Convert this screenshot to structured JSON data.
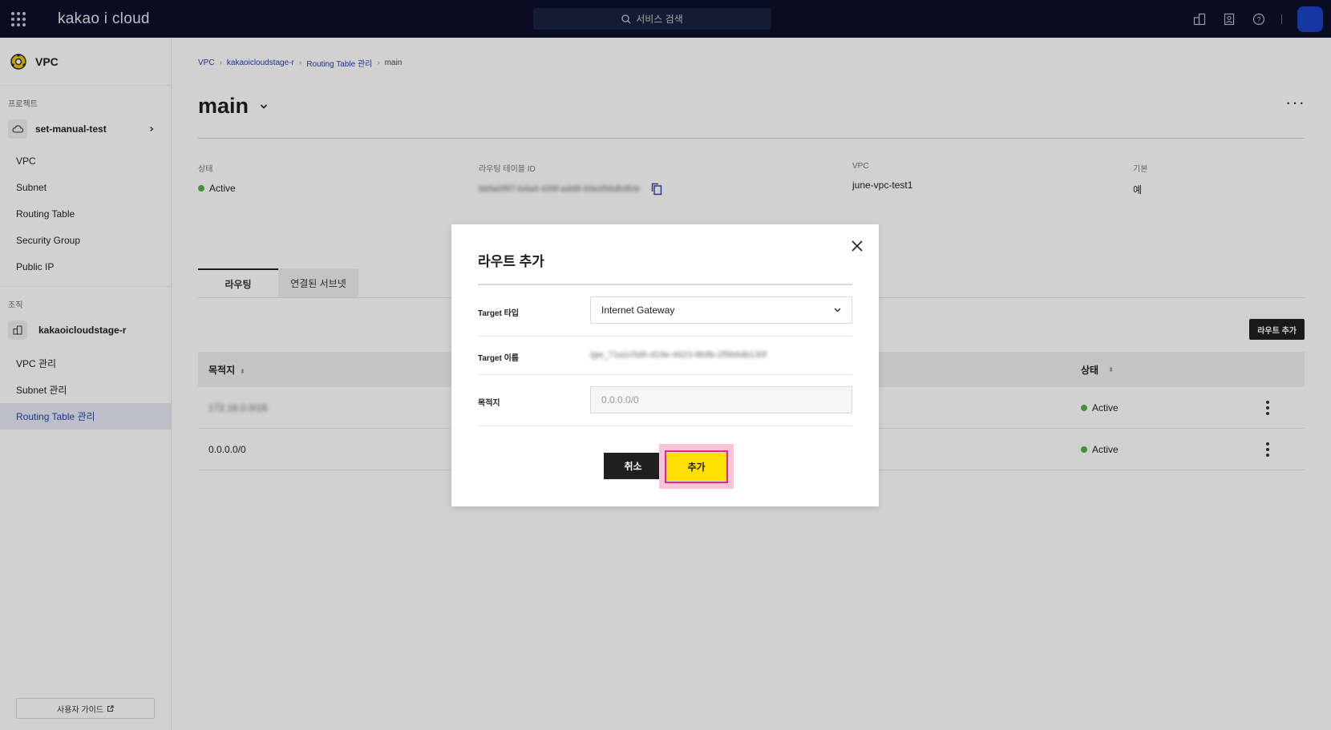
{
  "topbar": {
    "logo": "kakao i cloud",
    "search_placeholder": "서비스 검색"
  },
  "sidebar": {
    "service_title": "VPC",
    "project_label": "프로젝트",
    "project_name": "set-manual-test",
    "project_items": [
      {
        "label": "VPC"
      },
      {
        "label": "Subnet"
      },
      {
        "label": "Routing Table"
      },
      {
        "label": "Security Group"
      },
      {
        "label": "Public IP"
      }
    ],
    "org_label": "조직",
    "org_name": "kakaoicloudstage-r",
    "org_items": [
      {
        "label": "VPC 관리"
      },
      {
        "label": "Subnet 관리"
      },
      {
        "label": "Routing Table 관리"
      }
    ],
    "guide_label": "사용자 가이드"
  },
  "breadcrumb": {
    "items": [
      "VPC",
      "kakaoicloudstage-r",
      "Routing Table 관리"
    ],
    "current": "main"
  },
  "page": {
    "title": "main"
  },
  "info": {
    "status_label": "상태",
    "status_value": "Active",
    "rt_id_label": "라우팅 테이블 ID",
    "rt_id_value": "bb5e0f97-b4a4-439f-a4d8-93e356db3fcb",
    "vpc_label": "VPC",
    "vpc_value": "june-vpc-test1",
    "default_label": "기본",
    "default_value": "예"
  },
  "tabs": [
    {
      "label": "라우팅"
    },
    {
      "label": "연결된 서브넷"
    }
  ],
  "table": {
    "add_button": "라우트 추가",
    "col_destination": "목적지",
    "col_status": "상태",
    "rows": [
      {
        "destination": "172.16.0.0/16",
        "status": "Active"
      },
      {
        "destination": "0.0.0.0/0",
        "status": "Active"
      }
    ]
  },
  "modal": {
    "title": "라우트 추가",
    "target_type_label": "Target 타입",
    "target_type_value": "Internet Gateway",
    "target_name_label": "Target 이름",
    "target_name_value": "igw_71a1c5d6-d19e-4623-8b9b-2f5b6db130f",
    "destination_label": "목적지",
    "destination_placeholder": "0.0.0.0/0",
    "cancel_label": "취소",
    "confirm_label": "추가"
  },
  "colors": {
    "topbar_bg": "#0b0f2b",
    "accent_link": "#2a3ea3",
    "active_dot": "#52b244",
    "confirm_bg": "#ffe000",
    "highlight_border": "#e02d76"
  }
}
